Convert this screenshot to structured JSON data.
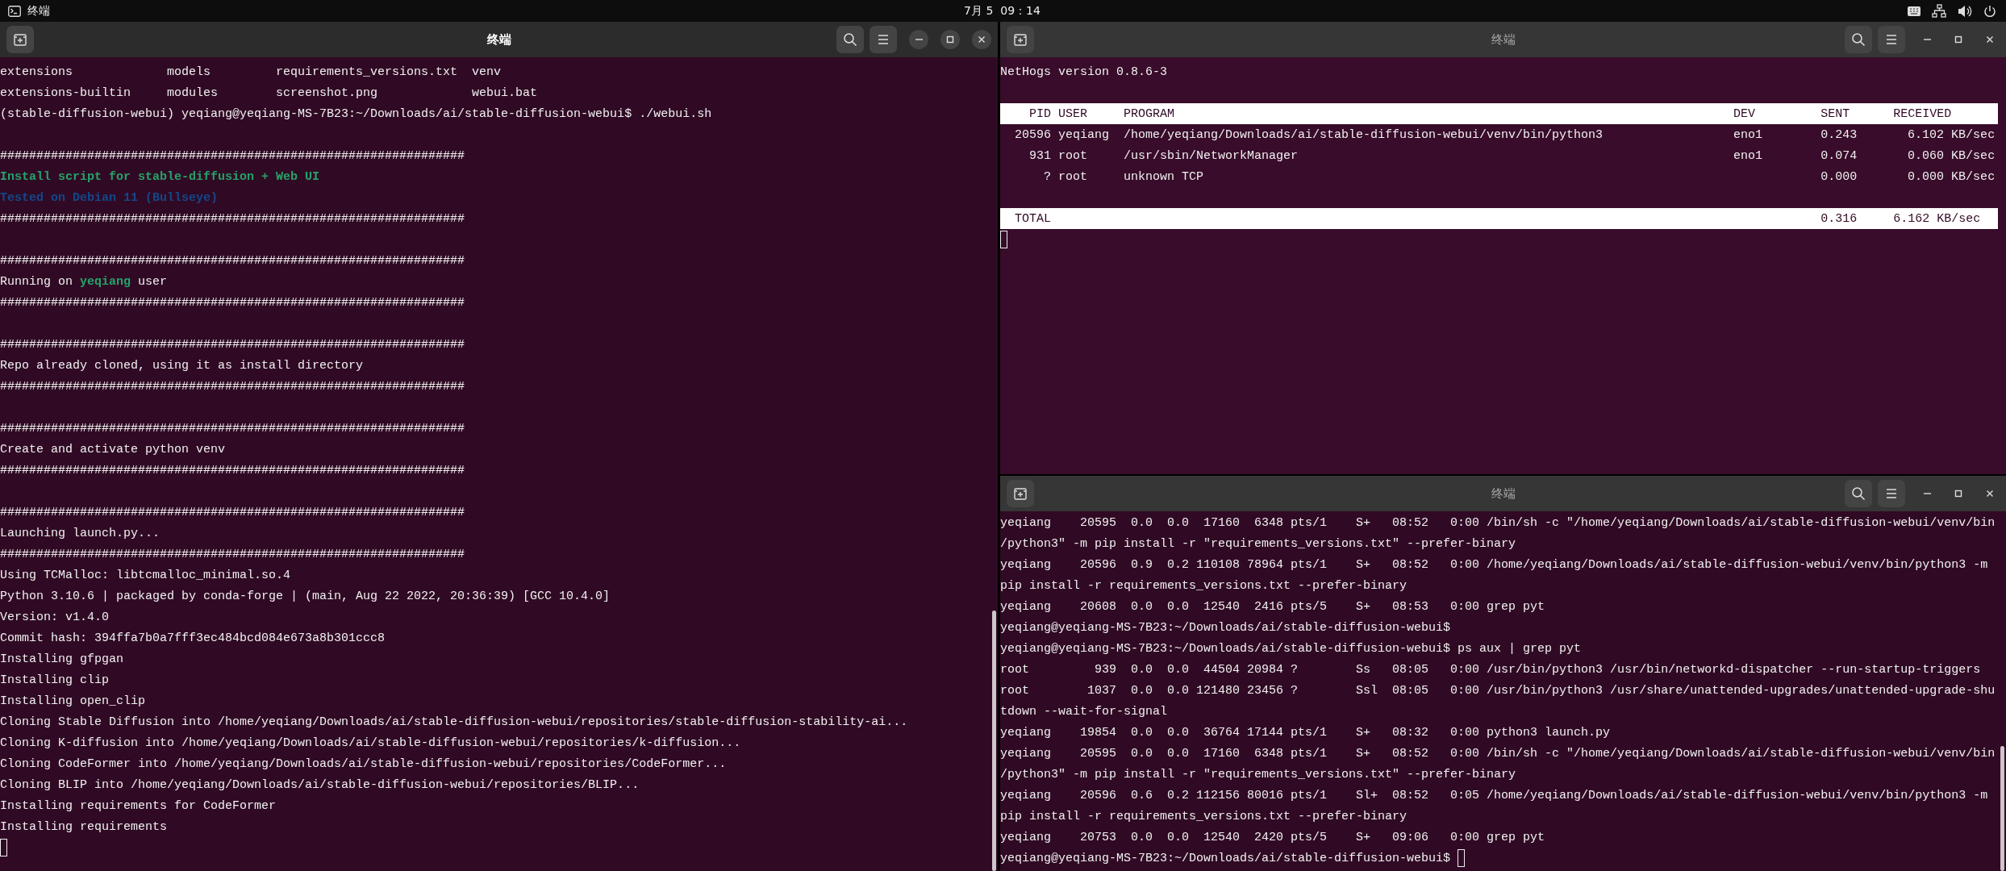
{
  "top_bar": {
    "app_name": "终端",
    "clock": "7月 5  09：14"
  },
  "windows": [
    {
      "kind": "terminal",
      "title": "终端",
      "focused": true,
      "lines": [
        {
          "kind": "text",
          "text": "extensions             models         requirements_versions.txt  venv"
        },
        {
          "kind": "text",
          "text": "extensions-builtin     modules        screenshot.png             webui.bat"
        },
        {
          "kind": "text",
          "text": "(stable-diffusion-webui) yeqiang@yeqiang-MS-7B23:~/Downloads/ai/stable-diffusion-webui$ ./webui.sh"
        },
        {
          "kind": "blank"
        },
        {
          "kind": "text",
          "text": "################################################################"
        },
        {
          "kind": "text",
          "text": "Install script for stable-diffusion + Web UI",
          "color": "#26a269"
        },
        {
          "kind": "text",
          "text": "Tested on Debian 11 (Bullseye)",
          "color": "#12488b"
        },
        {
          "kind": "text",
          "text": "################################################################"
        },
        {
          "kind": "blank"
        },
        {
          "kind": "text",
          "text": "################################################################"
        },
        {
          "kind": "text",
          "segments": [
            {
              "text": "Running on "
            },
            {
              "text": "yeqiang",
              "color": "#26a269"
            },
            {
              "text": " user"
            }
          ]
        },
        {
          "kind": "text",
          "text": "################################################################"
        },
        {
          "kind": "blank"
        },
        {
          "kind": "text",
          "text": "################################################################"
        },
        {
          "kind": "text",
          "text": "Repo already cloned, using it as install directory"
        },
        {
          "kind": "text",
          "text": "################################################################"
        },
        {
          "kind": "blank"
        },
        {
          "kind": "text",
          "text": "################################################################"
        },
        {
          "kind": "text",
          "text": "Create and activate python venv"
        },
        {
          "kind": "text",
          "text": "################################################################"
        },
        {
          "kind": "blank"
        },
        {
          "kind": "text",
          "text": "################################################################"
        },
        {
          "kind": "text",
          "text": "Launching launch.py..."
        },
        {
          "kind": "text",
          "text": "################################################################"
        },
        {
          "kind": "text",
          "text": "Using TCMalloc: libtcmalloc_minimal.so.4"
        },
        {
          "kind": "text",
          "text": "Python 3.10.6 | packaged by conda-forge | (main, Aug 22 2022, 20:36:39) [GCC 10.4.0]"
        },
        {
          "kind": "text",
          "text": "Version: v1.4.0"
        },
        {
          "kind": "text",
          "text": "Commit hash: 394ffa7b0a7fff3ec484bcd084e673a8b301ccc8"
        },
        {
          "kind": "text",
          "text": "Installing gfpgan"
        },
        {
          "kind": "text",
          "text": "Installing clip"
        },
        {
          "kind": "text",
          "text": "Installing open_clip"
        },
        {
          "kind": "text",
          "text": "Cloning Stable Diffusion into /home/yeqiang/Downloads/ai/stable-diffusion-webui/repositories/stable-diffusion-stability-ai..."
        },
        {
          "kind": "text",
          "text": "Cloning K-diffusion into /home/yeqiang/Downloads/ai/stable-diffusion-webui/repositories/k-diffusion..."
        },
        {
          "kind": "text",
          "text": "Cloning CodeFormer into /home/yeqiang/Downloads/ai/stable-diffusion-webui/repositories/CodeFormer..."
        },
        {
          "kind": "text",
          "text": "Cloning BLIP into /home/yeqiang/Downloads/ai/stable-diffusion-webui/repositories/BLIP..."
        },
        {
          "kind": "text",
          "text": "Installing requirements for CodeFormer"
        },
        {
          "kind": "text",
          "text": "Installing requirements"
        },
        {
          "kind": "cursor"
        }
      ]
    },
    {
      "kind": "nethogs",
      "title": "终端",
      "focused": false,
      "version": "NetHogs version 0.8.6-3",
      "columns": [
        "PID",
        "USER",
        "PROGRAM",
        "DEV",
        "SENT",
        "RECEIVED"
      ],
      "rows": [
        {
          "pid": "20596",
          "user": "yeqiang",
          "program": "/home/yeqiang/Downloads/ai/stable-diffusion-webui/venv/bin/python3",
          "dev": "eno1",
          "sent": "0.243",
          "received": "6.102 KB/sec"
        },
        {
          "pid": "931",
          "user": "root",
          "program": "/usr/sbin/NetworkManager",
          "dev": "eno1",
          "sent": "0.074",
          "received": "0.060 KB/sec"
        },
        {
          "pid": "?",
          "user": "root",
          "program": "unknown TCP",
          "sent": "0.000",
          "received": "0.000 KB/sec"
        }
      ],
      "total": {
        "label": "TOTAL",
        "sent": "0.316",
        "received": "6.162 KB/sec"
      }
    },
    {
      "kind": "terminal",
      "title": "终端",
      "focused": false,
      "lines": [
        {
          "kind": "text",
          "text": "yeqiang    20595  0.0  0.0  17160  6348 pts/1    S+   08:52   0:00 /bin/sh -c \"/home/yeqiang/Downloads/ai/stable-diffusion-webui/venv/bin"
        },
        {
          "kind": "text",
          "text": "/python3\" -m pip install -r \"requirements_versions.txt\" --prefer-binary"
        },
        {
          "kind": "text",
          "text": "yeqiang    20596  0.9  0.2 110108 78964 pts/1    S+   08:52   0:00 /home/yeqiang/Downloads/ai/stable-diffusion-webui/venv/bin/python3 -m"
        },
        {
          "kind": "text",
          "text": "pip install -r requirements_versions.txt --prefer-binary"
        },
        {
          "kind": "text",
          "text": "yeqiang    20608  0.0  0.0  12540  2416 pts/5    S+   08:53   0:00 grep pyt"
        },
        {
          "kind": "text",
          "text": "yeqiang@yeqiang-MS-7B23:~/Downloads/ai/stable-diffusion-webui$"
        },
        {
          "kind": "text",
          "text": "yeqiang@yeqiang-MS-7B23:~/Downloads/ai/stable-diffusion-webui$ ps aux | grep pyt"
        },
        {
          "kind": "text",
          "text": "root         939  0.0  0.0  44504 20984 ?        Ss   08:05   0:00 /usr/bin/python3 /usr/bin/networkd-dispatcher --run-startup-triggers"
        },
        {
          "kind": "text",
          "text": "root        1037  0.0  0.0 121480 23456 ?        Ssl  08:05   0:00 /usr/bin/python3 /usr/share/unattended-upgrades/unattended-upgrade-shu"
        },
        {
          "kind": "text",
          "text": "tdown --wait-for-signal"
        },
        {
          "kind": "text",
          "text": "yeqiang    19854  0.0  0.0  36764 17144 pts/1    S+   08:32   0:00 python3 launch.py"
        },
        {
          "kind": "text",
          "text": "yeqiang    20595  0.0  0.0  17160  6348 pts/1    S+   08:52   0:00 /bin/sh -c \"/home/yeqiang/Downloads/ai/stable-diffusion-webui/venv/bin"
        },
        {
          "kind": "text",
          "text": "/python3\" -m pip install -r \"requirements_versions.txt\" --prefer-binary"
        },
        {
          "kind": "text",
          "text": "yeqiang    20596  0.6  0.2 112156 80016 pts/1    Sl+  08:52   0:05 /home/yeqiang/Downloads/ai/stable-diffusion-webui/venv/bin/python3 -m"
        },
        {
          "kind": "text",
          "text": "pip install -r requirements_versions.txt --prefer-binary"
        },
        {
          "kind": "text",
          "text": "yeqiang    20753  0.0  0.0  12540  2420 pts/5    S+   09:06   0:00 grep pyt"
        },
        {
          "kind": "text",
          "text": "yeqiang@yeqiang-MS-7B23:~/Downloads/ai/stable-diffusion-webui$",
          "cursor": true
        }
      ]
    }
  ]
}
